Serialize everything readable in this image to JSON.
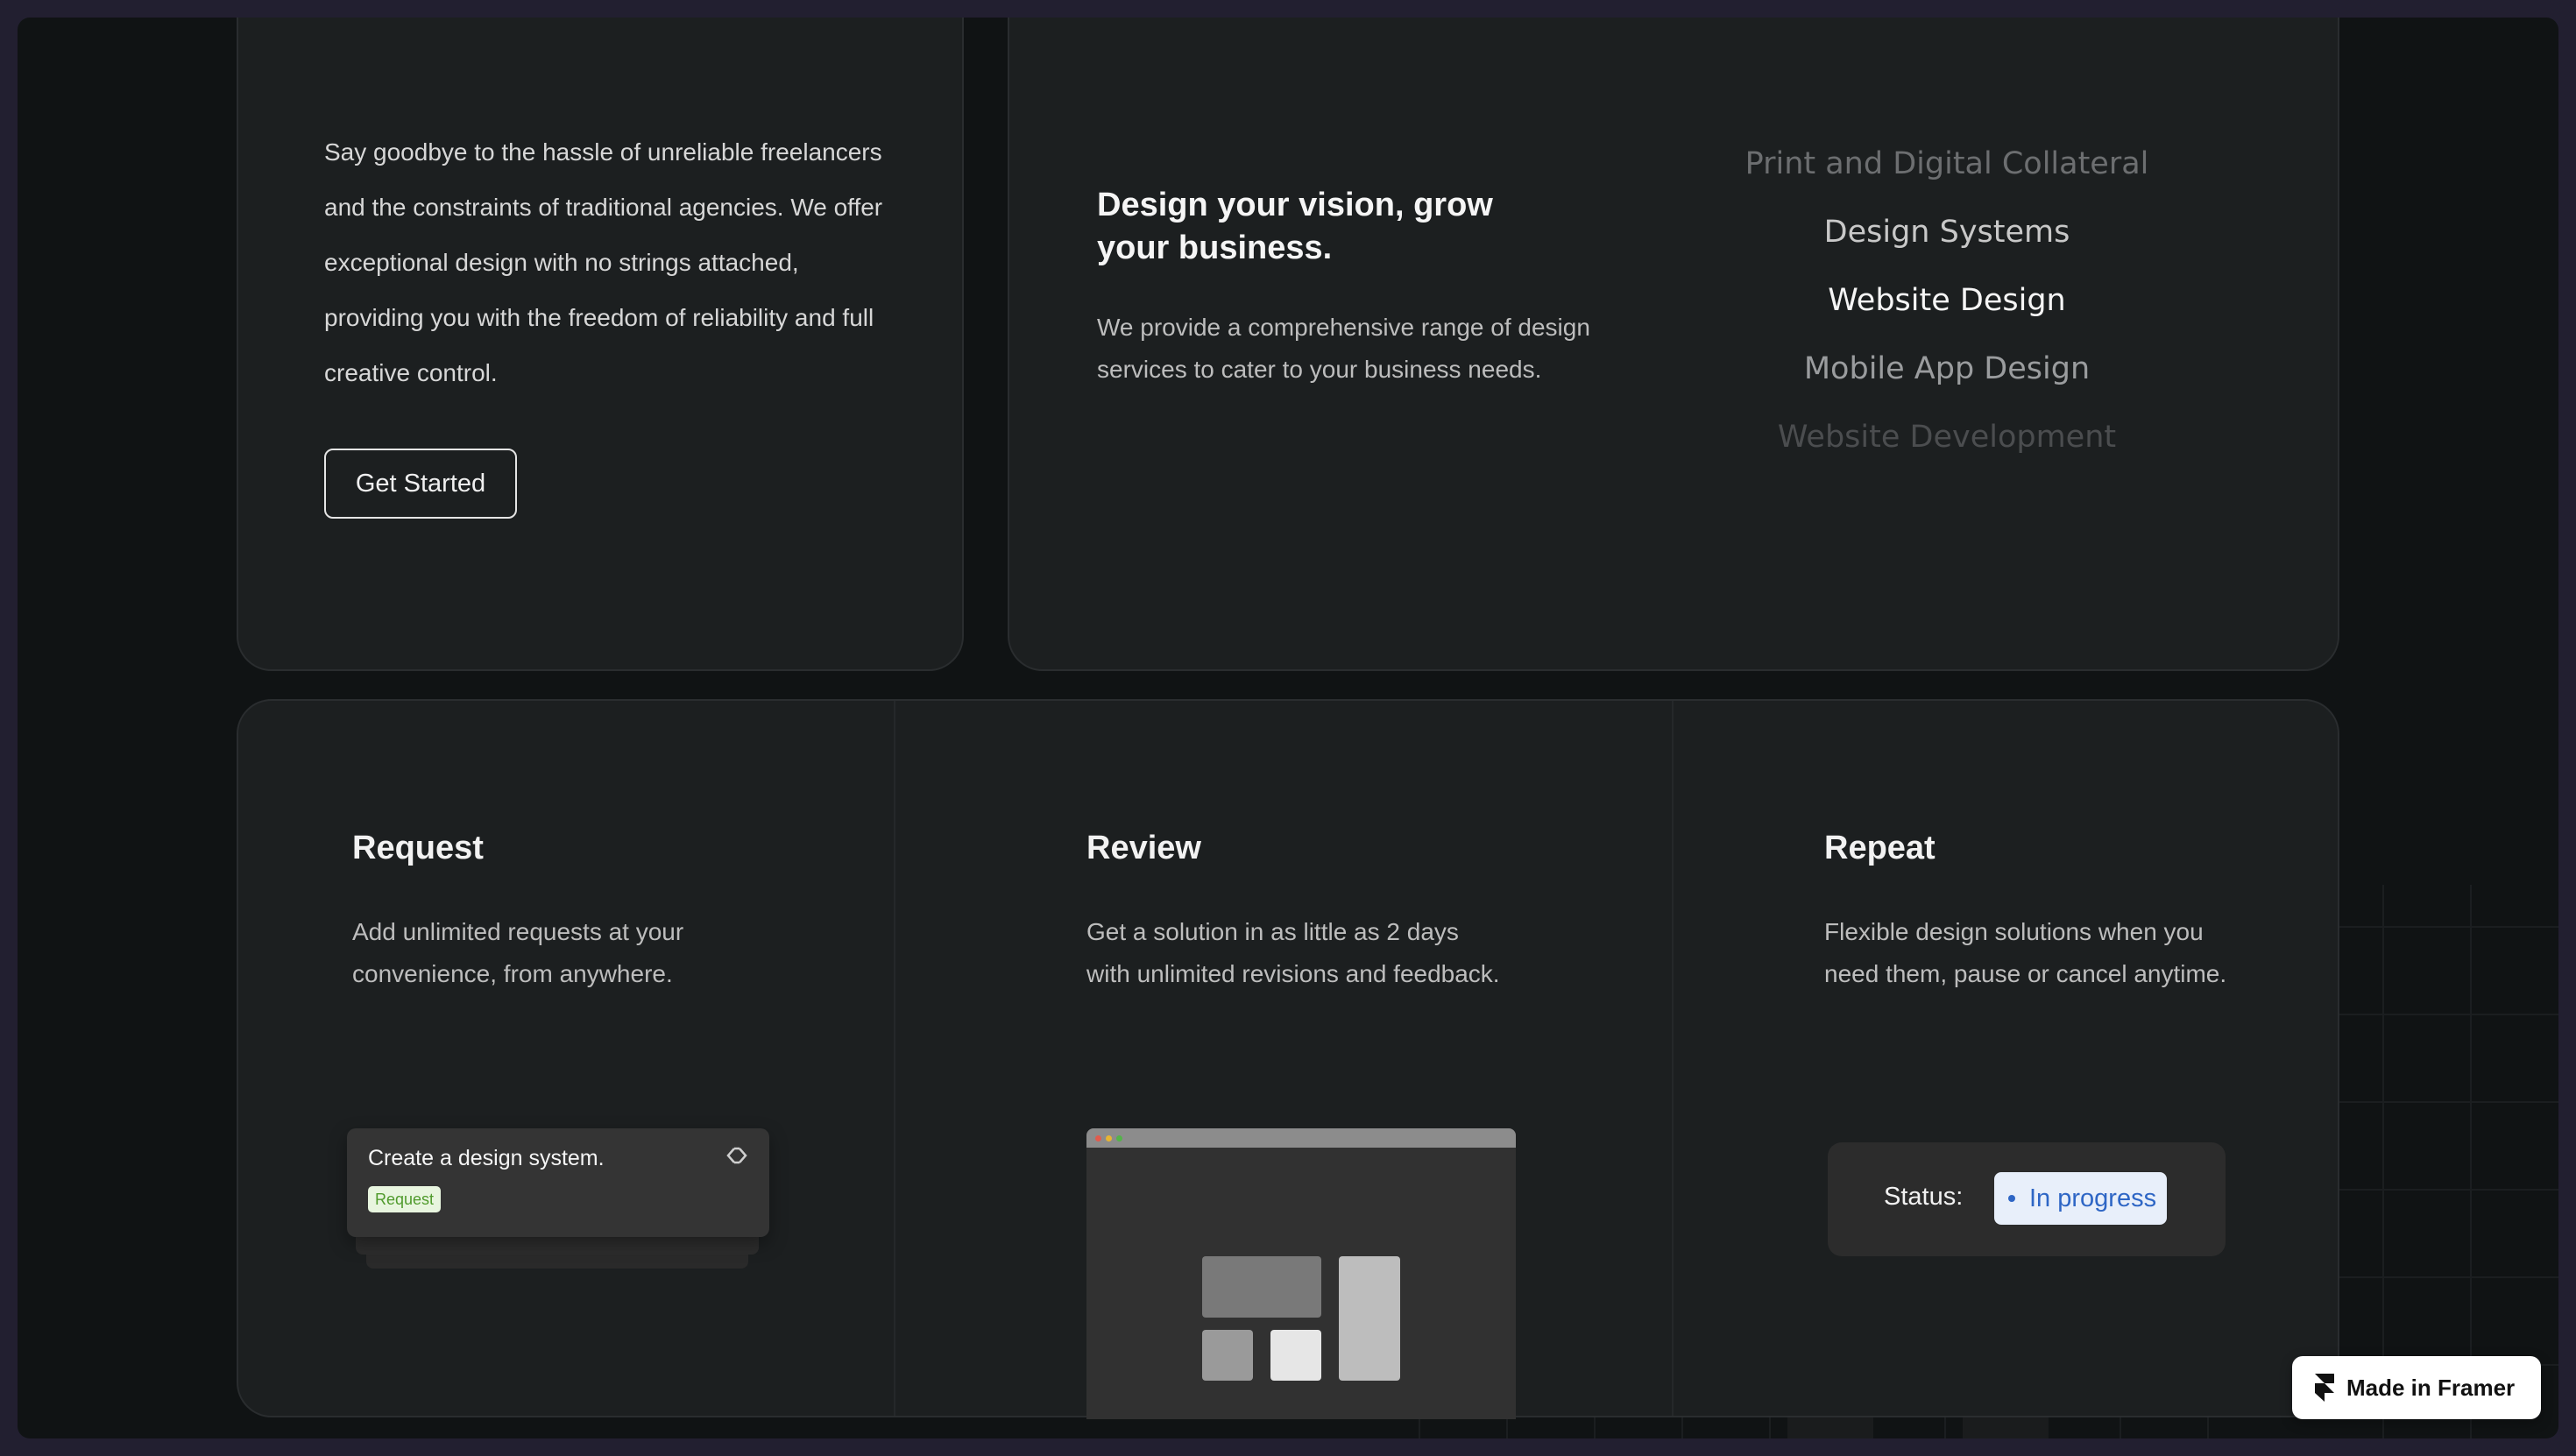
{
  "intro": {
    "text": "Say goodbye to the hassle of unreliable freelancers and the constraints of traditional agencies. We offer exceptional design with no strings attached, providing you with the freedom of reliability and full creative control.",
    "cta_label": "Get Started"
  },
  "vision": {
    "title": "Design your vision, grow your business.",
    "description": "We provide a comprehensive range of design services to cater to your business needs."
  },
  "services": {
    "items": [
      "Print and Digital Collateral",
      "Design Systems",
      "Website Design",
      "Mobile App Design",
      "Website Development"
    ],
    "active_index": 2
  },
  "steps": [
    {
      "title": "Request",
      "description": "Add unlimited requests at your convenience, from anywhere."
    },
    {
      "title": "Review",
      "description": "Get a solution in as little as 2 days with unlimited revisions and feedback."
    },
    {
      "title": "Repeat",
      "description": "Flexible design solutions when you need them, pause or cancel anytime."
    }
  ],
  "request_card": {
    "title": "Create a design system.",
    "badge": "Request"
  },
  "status_card": {
    "label": "Status:",
    "value": "In progress"
  },
  "framer_badge": {
    "label": "Made in Framer"
  },
  "colors": {
    "page_bg": "#101314",
    "card_bg": "#1c1f20",
    "status_blue": "#2e66c5",
    "badge_green": "#4f9a2c",
    "outer_frame": "#221f30"
  }
}
